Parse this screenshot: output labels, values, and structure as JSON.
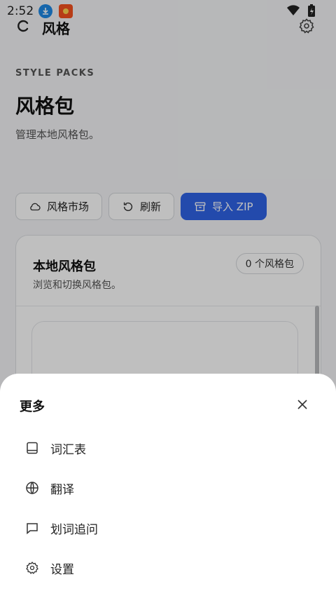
{
  "status": {
    "time": "2:52"
  },
  "header": {
    "title": "风格"
  },
  "page": {
    "eyebrow": "STYLE PACKS",
    "title": "风格包",
    "description": "管理本地风格包。"
  },
  "actions": {
    "market": "风格市场",
    "refresh": "刷新",
    "import_zip": "导入 ZIP"
  },
  "card": {
    "title": "本地风格包",
    "subtitle": "浏览和切换风格包。",
    "count": "0 个风格包"
  },
  "sheet": {
    "title": "更多",
    "items": [
      {
        "label": "词汇表",
        "icon": "book-icon"
      },
      {
        "label": "翻译",
        "icon": "globe-icon"
      },
      {
        "label": "划词追问",
        "icon": "chat-icon"
      },
      {
        "label": "设置",
        "icon": "gear-icon"
      }
    ]
  },
  "colors": {
    "accent": "#2f63e6"
  }
}
